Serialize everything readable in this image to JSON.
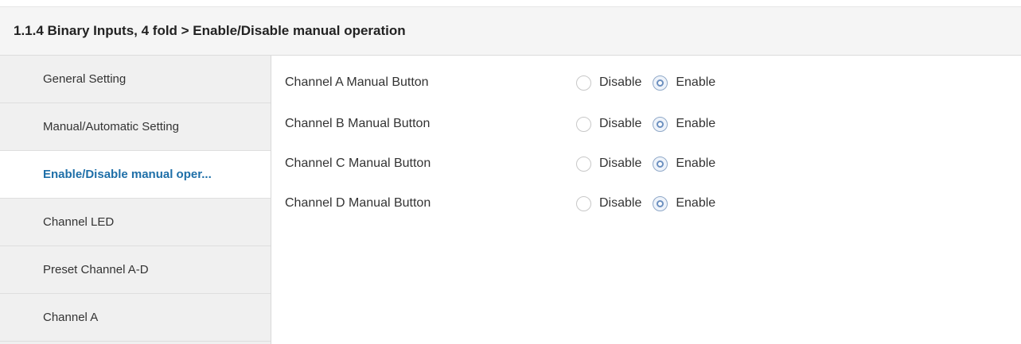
{
  "header": {
    "title": "1.1.4 Binary Inputs, 4 fold > Enable/Disable manual operation"
  },
  "sidebar": {
    "items": [
      {
        "label": "General Setting"
      },
      {
        "label": "Manual/Automatic Setting"
      },
      {
        "label": "Enable/Disable manual oper...",
        "active": true
      },
      {
        "label": "Channel LED"
      },
      {
        "label": "Preset Channel A-D"
      },
      {
        "label": "Channel A"
      }
    ]
  },
  "params": {
    "rows": [
      {
        "label": "Channel A Manual Button",
        "options": [
          "Disable",
          "Enable"
        ],
        "selected": "Enable"
      },
      {
        "label": "Channel B Manual Button",
        "options": [
          "Disable",
          "Enable"
        ],
        "selected": "Enable"
      },
      {
        "label": "Channel C Manual Button",
        "options": [
          "Disable",
          "Enable"
        ],
        "selected": "Enable"
      },
      {
        "label": "Channel D Manual Button",
        "options": [
          "Disable",
          "Enable"
        ],
        "selected": "Enable"
      }
    ]
  },
  "colors": {
    "active_text": "#1e6fa8",
    "sidebar_bg": "#f0f0f0",
    "header_bg": "#f5f5f5",
    "radio_accent": "#6b8fbf"
  }
}
